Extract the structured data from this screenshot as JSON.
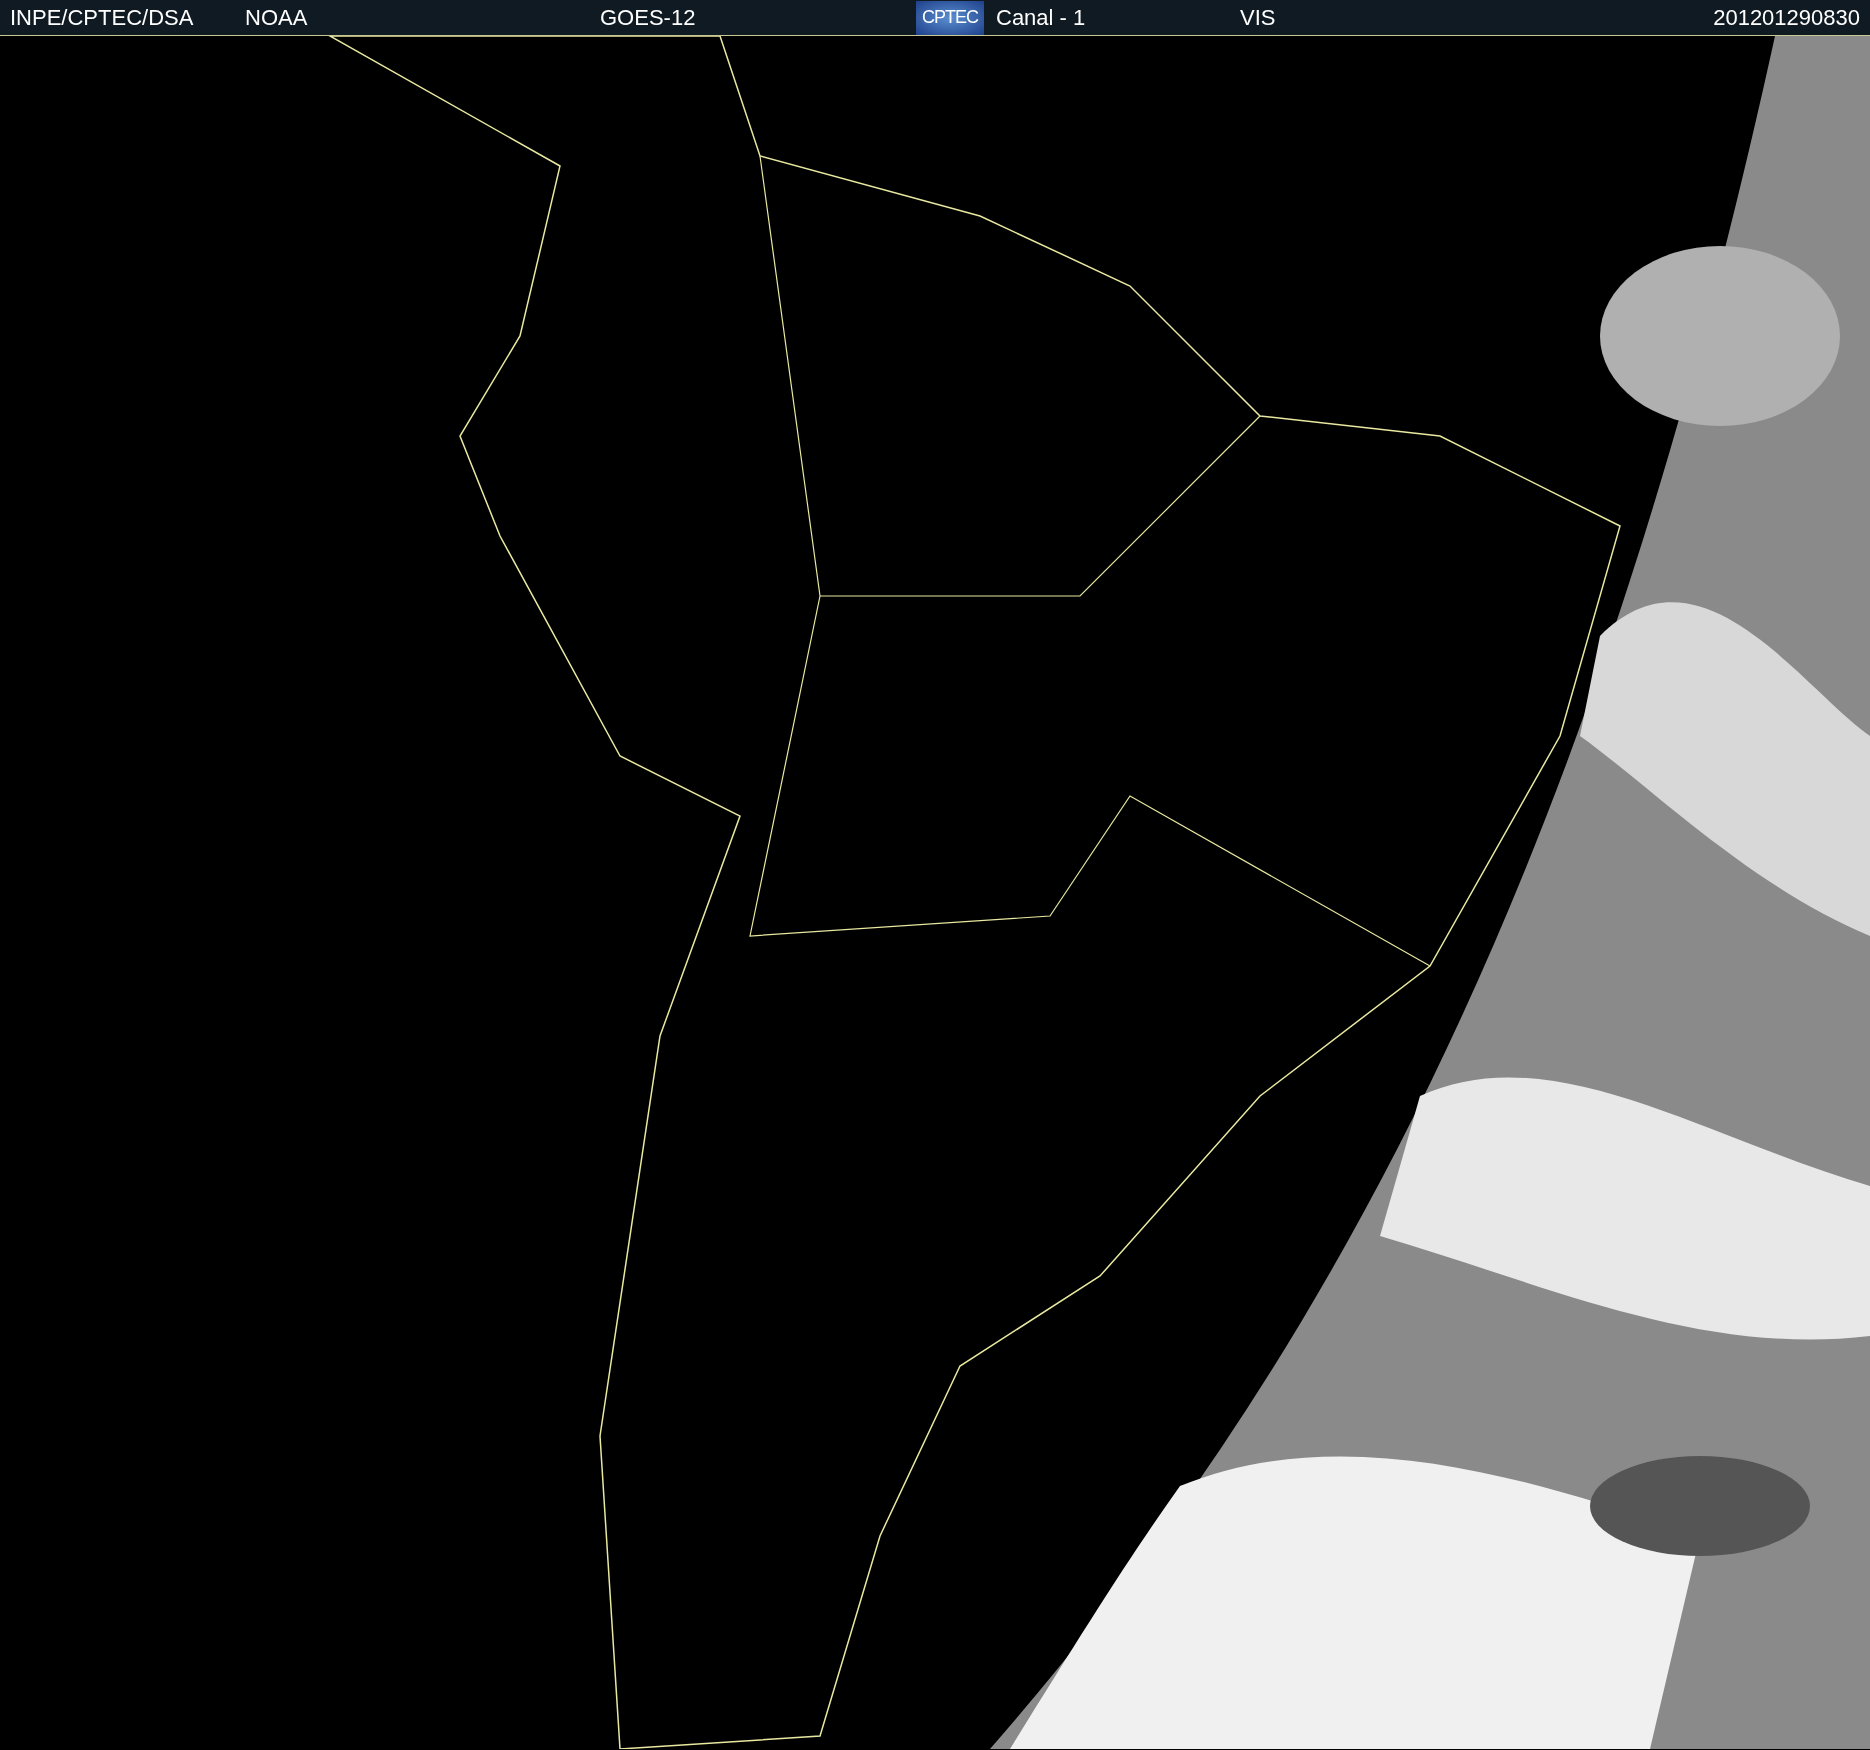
{
  "header": {
    "source": "INPE/CPTEC/DSA",
    "agency": "NOAA",
    "satellite": "GOES-12",
    "logo": "CPTEC",
    "channel": "Canal - 1",
    "band": "VIS",
    "timestamp": "201201290830"
  }
}
